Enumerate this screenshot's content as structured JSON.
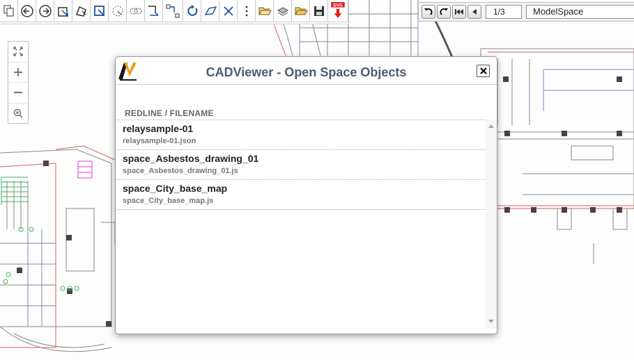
{
  "toolbar": {
    "tools": [
      {
        "icon": "copy-icon"
      },
      {
        "icon": "back-icon"
      },
      {
        "icon": "forward-icon"
      },
      {
        "icon": "zoom-extents-icon"
      },
      {
        "icon": "pan-icon"
      },
      {
        "icon": "zoom-window-icon"
      },
      {
        "icon": "circle-select-icon"
      },
      {
        "icon": "cloud-icon"
      },
      {
        "icon": "rectangle-select-icon"
      },
      {
        "icon": "move-icon"
      },
      {
        "icon": "rotate-icon"
      },
      {
        "icon": "eraser-icon"
      },
      {
        "icon": "clear-icon"
      },
      {
        "icon": "more-icon"
      },
      {
        "icon": "open-folder-icon"
      },
      {
        "icon": "layers-icon"
      },
      {
        "icon": "open-file-icon"
      },
      {
        "icon": "save-icon"
      },
      {
        "icon": "svg-download-icon",
        "badge": "SVG"
      }
    ]
  },
  "navigation": {
    "page": "1/3",
    "layout": "ModelSpace"
  },
  "zoom_controls": [
    "zoom-extents-icon",
    "zoom-in-icon",
    "zoom-out-icon",
    "zoom-window-icon"
  ],
  "modal": {
    "title": "CADViewer - Open Space Objects",
    "column_header": "REDLINE / FILENAME",
    "items": [
      {
        "title": "relaysample-01",
        "file": "relaysample-01.json"
      },
      {
        "title": "space_Asbestos_drawing_01",
        "file": "space_Asbestos_drawing_01.js"
      },
      {
        "title": "space_City_base_map",
        "file": "space_City_base_map.js"
      }
    ]
  },
  "colors": {
    "title": "#4a5a72",
    "accent_red": "#e02020",
    "logo_orange": "#f0a020",
    "drawing_line": "#777777",
    "drawing_wall": "#555555",
    "drawing_blue": "#7b89c4",
    "drawing_red": "#d65a5a",
    "drawing_green": "#3cb45a"
  }
}
